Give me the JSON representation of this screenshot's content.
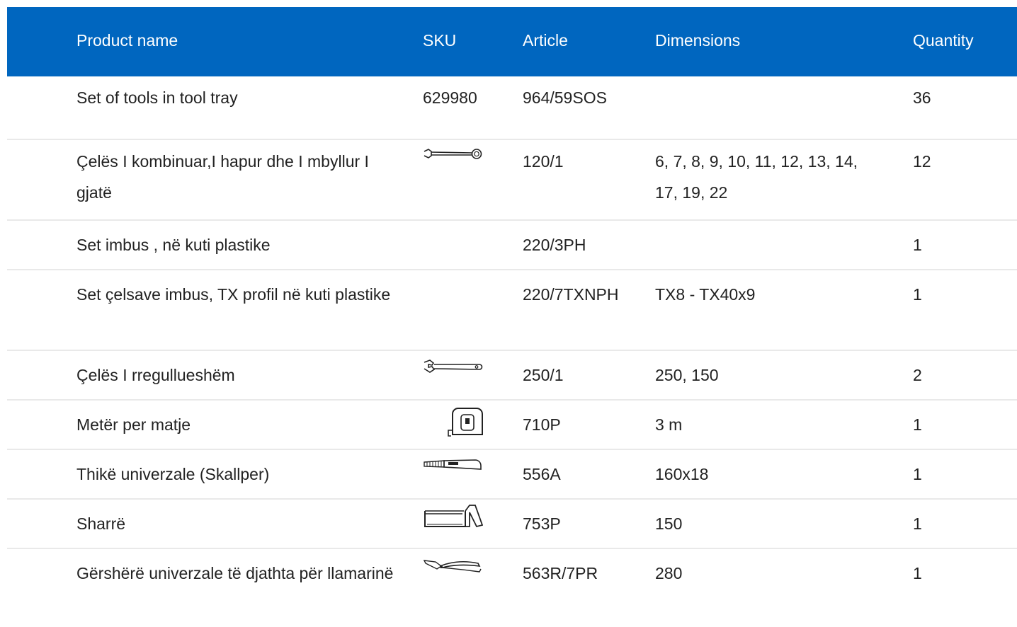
{
  "columns": {
    "name": "Product name",
    "sku": "SKU",
    "article": "Article",
    "dimensions": "Dimensions",
    "quantity": "Quantity"
  },
  "rows": [
    {
      "name": "Set of tools in tool tray",
      "sku": "629980",
      "article": "964/59SOS",
      "dimensions": "",
      "quantity": "36"
    },
    {
      "name": "Çelës I kombinuar,I hapur dhe I mbyllur I gjatë",
      "sku_icon": "combination-wrench-icon",
      "article": "120/1",
      "dimensions": "6, 7, 8, 9, 10, 11, 12, 13, 14, 17, 19, 22",
      "quantity": "12"
    },
    {
      "name": "Set imbus , në kuti plastike",
      "article": "220/3PH",
      "dimensions": "",
      "quantity": "1"
    },
    {
      "name": "Set çelsave imbus, TX profil në kuti plastike",
      "article": "220/7TXNPH",
      "dimensions": "TX8 - TX40x9",
      "quantity": "1"
    },
    {
      "name": "Çelës I rregullueshëm",
      "sku_icon": "adjustable-wrench-icon",
      "article": "250/1",
      "dimensions": "250, 150",
      "quantity": "2"
    },
    {
      "name": "Metër per matje",
      "sku_icon": "tape-measure-icon",
      "article": "710P",
      "dimensions": "3 m",
      "quantity": "1"
    },
    {
      "name": "Thikë univerzale (Skallper)",
      "sku_icon": "utility-knife-icon",
      "article": "556A",
      "dimensions": "160x18",
      "quantity": "1"
    },
    {
      "name": "Sharrë",
      "sku_icon": "hacksaw-icon",
      "article": "753P",
      "dimensions": "150",
      "quantity": "1"
    },
    {
      "name": "Gërshërë univerzale të djathta për llamarinë",
      "sku_icon": "tin-snips-icon",
      "article": "563R/7PR",
      "dimensions": "280",
      "quantity": "1"
    }
  ],
  "colors": {
    "header_bg": "#0066bf",
    "header_text": "#ffffff",
    "row_divider": "#e9e9e9",
    "text": "#222222"
  }
}
